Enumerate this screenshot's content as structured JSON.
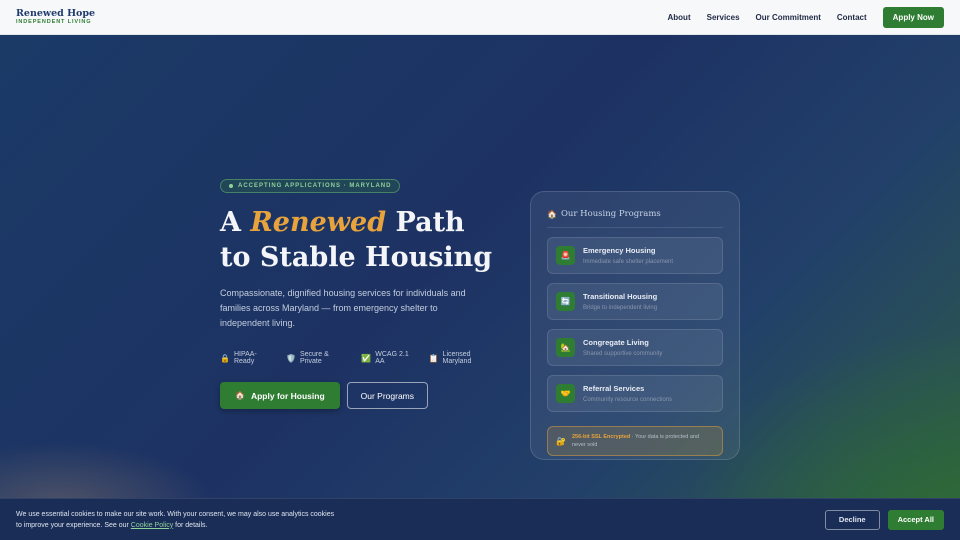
{
  "nav": {
    "brand_name": "Renewed Hope",
    "brand_tag": "INDEPENDENT LIVING",
    "links": [
      "About",
      "Services",
      "Our Commitment",
      "Contact"
    ],
    "cta": "Apply Now"
  },
  "hero": {
    "badge": "ACCEPTING APPLICATIONS · MARYLAND",
    "headline_pre": "A ",
    "headline_accent": "Renewed",
    "headline_post": " Path",
    "headline_line2": "to Stable Housing",
    "lede": "Compassionate, dignified housing services for individuals and families across Maryland — from emergency shelter to independent living.",
    "trust": [
      {
        "icon": "lock-icon",
        "glyph": "🔒",
        "label": "HIPAA-Ready"
      },
      {
        "icon": "shield-icon",
        "glyph": "🛡️",
        "label": "Secure & Private"
      },
      {
        "icon": "check-icon",
        "glyph": "✅",
        "label": "WCAG 2.1 AA"
      },
      {
        "icon": "clipboard-icon",
        "glyph": "📋",
        "label": "Licensed Maryland"
      }
    ],
    "primary_cta_glyph": "🏠",
    "primary_cta": "Apply for Housing",
    "secondary_cta": "Our Programs"
  },
  "card": {
    "title_glyph": "🏠",
    "title": "Our Housing Programs",
    "programs": [
      {
        "icon": "siren-icon",
        "glyph": "🚨",
        "name": "Emergency Housing",
        "desc": "Immediate safe shelter placement"
      },
      {
        "icon": "cycle-icon",
        "glyph": "🔄",
        "name": "Transitional Housing",
        "desc": "Bridge to independent living"
      },
      {
        "icon": "house-icon",
        "glyph": "🏡",
        "name": "Congregate Living",
        "desc": "Shared supportive community"
      },
      {
        "icon": "handshake-icon",
        "glyph": "🤝",
        "name": "Referral Services",
        "desc": "Community resource connections"
      }
    ],
    "secure_glyph": "🔐",
    "secure_strong": "256-bit SSL Encrypted",
    "secure_rest": " · Your data is protected and never sold"
  },
  "cookie": {
    "text_pre": "We use essential cookies to make our site work. With your consent, we may also use analytics cookies to improve your experience. See our ",
    "link": "Cookie Policy",
    "text_post": " for details.",
    "decline": "Decline",
    "accept": "Accept All"
  }
}
